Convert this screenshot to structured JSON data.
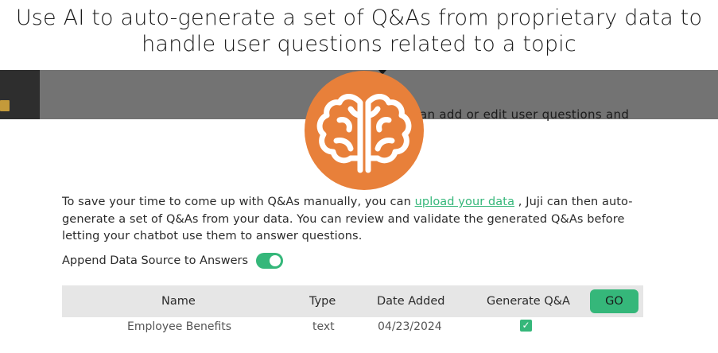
{
  "headline": {
    "line1": "Use AI to auto-generate a set of Q&As from proprietary data to",
    "line2": "handle user questions related to a topic"
  },
  "background_panel": {
    "partial_text": "an add or edit user questions and"
  },
  "description": {
    "before_link": "To save your time to come up with Q&As manually, you can ",
    "link_text": "upload your data",
    "after_link": " , Juji can then auto-generate a set of Q&As from your data. You can review and validate the generated Q&As before letting your chatbot use them to answer questions."
  },
  "append_toggle": {
    "label": "Append Data Source to Answers",
    "on": true
  },
  "table": {
    "columns": [
      "Name",
      "Type",
      "Date Added",
      "Generate Q&A"
    ],
    "go_label": "GO",
    "rows": [
      {
        "name": "Employee Benefits",
        "type": "text",
        "date_added": "04/23/2024",
        "generate": true
      }
    ]
  },
  "colors": {
    "accent": "#35b77a",
    "logo_orange": "#e8803a",
    "header_bg": "#e6e6e6",
    "overlay_strip": "#737373"
  },
  "icons": {
    "logo": "brain-icon",
    "checkbox": "checkmark-icon"
  }
}
